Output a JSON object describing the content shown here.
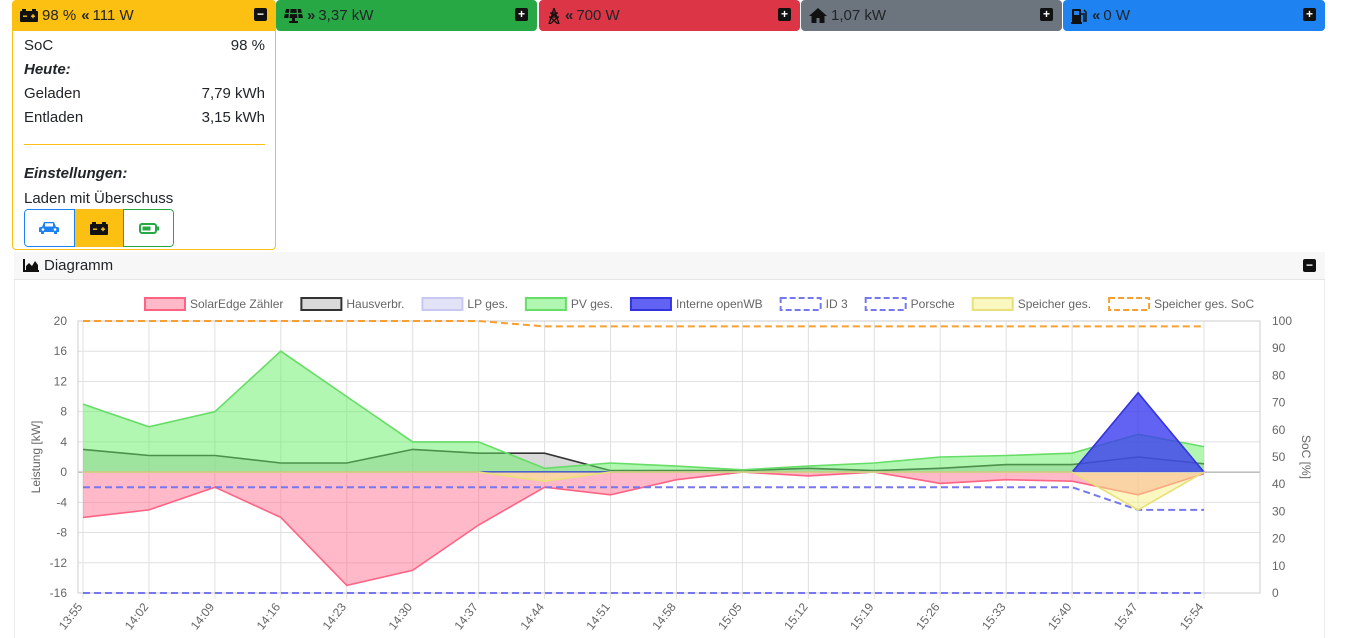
{
  "tiles": {
    "battery": {
      "soc": "98 %",
      "power": "111 W",
      "arrow": "«",
      "icon": "battery-charging-icon"
    },
    "pv": {
      "power": "3,37 kW",
      "arrow": "»",
      "icon": "solar-panel-icon"
    },
    "grid": {
      "power": "700 W",
      "arrow": "«",
      "icon": "power-pylon-icon"
    },
    "house": {
      "power": "1,07 kW",
      "icon": "house-icon"
    },
    "chargepoint": {
      "power": "0 W",
      "arrow": "«",
      "icon": "charging-station-icon"
    },
    "toggle_symbol": "−",
    "expand_symbol": "+"
  },
  "battery_panel": {
    "soc_label": "SoC",
    "soc_value": "98 %",
    "today_heading": "Heute:",
    "charged_label": "Geladen",
    "charged_value": "7,79 kWh",
    "discharged_label": "Entladen",
    "discharged_value": "3,15 kWh",
    "settings_heading": "Einstellungen:",
    "mode_label": "Laden mit Überschuss",
    "mode_buttons": [
      "car-icon",
      "battery-icon",
      "battery-empty-icon"
    ],
    "active_mode": 1
  },
  "diagram": {
    "title": "Diagramm",
    "icon": "chart-area-icon"
  },
  "colors": {
    "battery": "#fcc012",
    "pv": "#28a745",
    "grid": "#dc3545",
    "house": "#6c757d",
    "ev": "#1e82f0"
  },
  "chart_data": {
    "type": "area",
    "xlabel": "",
    "ylabel": "Leistung [kW]",
    "y2label": "SoC [%]",
    "ylim": [
      -16,
      20
    ],
    "y2lim": [
      0,
      100
    ],
    "yticks": [
      20,
      16,
      12,
      8,
      4,
      0,
      -4,
      -8,
      -12,
      -16
    ],
    "y2ticks": [
      100,
      90,
      80,
      70,
      60,
      50,
      40,
      30,
      20,
      10,
      0
    ],
    "x": [
      "13:55",
      "14:02",
      "14:09",
      "14:16",
      "14:23",
      "14:30",
      "14:37",
      "14:44",
      "14:51",
      "14:58",
      "15:05",
      "15:12",
      "15:19",
      "15:26",
      "15:33",
      "15:40",
      "15:47",
      "15:54"
    ],
    "legend_placement": "top",
    "grid": true,
    "series": [
      {
        "name": "SolarEdge Zähler",
        "color": "#ff6384",
        "fill": "rgba(255,99,132,0.45)",
        "values": [
          -6,
          -5,
          -2,
          -6,
          -15,
          -13,
          -7,
          -2,
          -3,
          -1,
          0,
          -0.5,
          0,
          -1.5,
          -1,
          -1.2,
          -3,
          -0.2
        ]
      },
      {
        "name": "Hausverbr.",
        "color": "#333333",
        "fill": "rgba(180,180,180,0.5)",
        "values": [
          3,
          2.2,
          2.2,
          1.2,
          1.2,
          3,
          2.5,
          2.5,
          0.2,
          0.2,
          0.2,
          0.5,
          0.2,
          0.5,
          1,
          1,
          2,
          1.1
        ]
      },
      {
        "name": "LP ges.",
        "color": "#c8c8f0",
        "fill": "rgba(200,200,240,0.5)",
        "values": [
          0,
          0,
          0,
          0,
          0,
          0,
          0,
          0,
          0,
          0,
          0,
          0,
          0,
          0,
          0,
          0,
          0,
          0
        ]
      },
      {
        "name": "PV ges.",
        "color": "#66dd66",
        "fill": "rgba(100,240,100,0.5)",
        "values": [
          9,
          6,
          8,
          16,
          10,
          4,
          4,
          0.5,
          1.2,
          0.8,
          0.3,
          0.8,
          1.2,
          2,
          2.2,
          2.5,
          5,
          3.37
        ]
      },
      {
        "name": "Interne openWB",
        "color": "#3333dd",
        "fill": "rgba(60,60,240,0.8)",
        "values": [
          0,
          0,
          0,
          0,
          0,
          0,
          0,
          0,
          0,
          0,
          0,
          0,
          0,
          0,
          0,
          0,
          10.5,
          0
        ]
      },
      {
        "name": "ID 3",
        "color": "#7777ee",
        "dashed": true,
        "values": [
          -16,
          -16,
          -16,
          -16,
          -16,
          -16,
          -16,
          -16,
          -16,
          -16,
          -16,
          -16,
          -16,
          -16,
          -16,
          -16,
          -16,
          -16
        ]
      },
      {
        "name": "Porsche",
        "color": "#7777ee",
        "dashed": true,
        "values": [
          -2,
          -2,
          -2,
          -2,
          -2,
          -2,
          -2,
          -2,
          -2,
          -2,
          -2,
          -2,
          -2,
          -2,
          -2,
          -2,
          -5,
          -5
        ]
      },
      {
        "name": "Speicher ges.",
        "color": "#e8e07a",
        "fill": "rgba(245,240,130,0.5)",
        "values": [
          0,
          0,
          0,
          0,
          0,
          0,
          0,
          -1.2,
          0,
          0,
          0,
          0,
          0,
          0,
          0,
          0,
          -5,
          0
        ]
      },
      {
        "name": "Speicher ges. SoC",
        "color": "#f5a030",
        "dashed": true,
        "axis": "right",
        "values": [
          100,
          100,
          100,
          100,
          100,
          100,
          100,
          98,
          98,
          98,
          98,
          98,
          98,
          98,
          98,
          98,
          98,
          98
        ]
      }
    ]
  }
}
